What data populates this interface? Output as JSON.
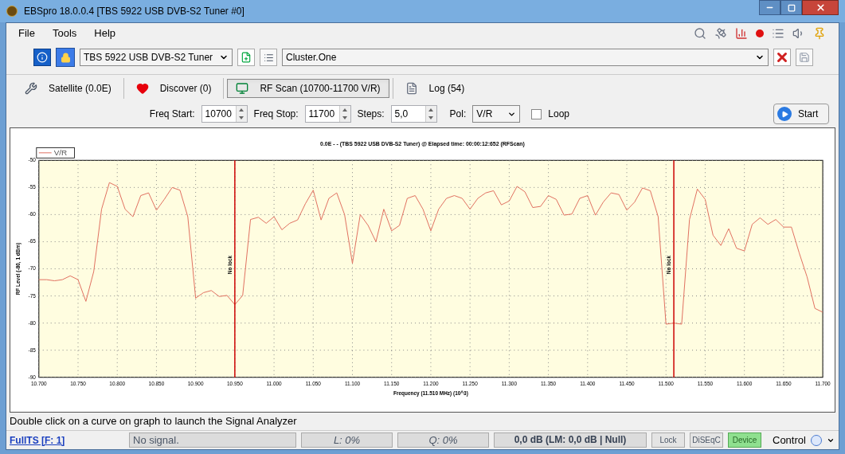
{
  "window": {
    "title": "EBSpro 18.0.0.4 [TBS 5922 USB DVB-S2 Tuner #0]"
  },
  "menu": [
    "File",
    "Tools",
    "Help"
  ],
  "toolbar": {
    "tuner": "TBS 5922 USB DVB-S2 Tuner",
    "cluster": "Cluster.One"
  },
  "tabs": [
    {
      "label": "Satellite (0.0E)",
      "selected": false,
      "kind": "satellite"
    },
    {
      "label": "Discover (0)",
      "selected": false,
      "kind": "discover"
    },
    {
      "label": "RF Scan (10700-11700 V/R)",
      "selected": true,
      "kind": "scan"
    },
    {
      "label": "Log (54)",
      "selected": false,
      "kind": "log"
    }
  ],
  "scan_settings": {
    "freq_start_label": "Freq Start:",
    "freq_start": "10700",
    "freq_stop_label": "Freq Stop:",
    "freq_stop": "11700",
    "steps_label": "Steps:",
    "steps": "5,0",
    "pol_label": "Pol:",
    "pol": "V/R",
    "loop_label": "Loop",
    "loop_checked": false,
    "start_button": "Start"
  },
  "chart_data": {
    "type": "line",
    "title": "0.0E - - (TBS 5922 USB DVB-S2 Tuner) @ Elapsed time: 00:00:12:652 (RFScan)",
    "xlabel": "Frequency (11.510 MHz) (10^3)",
    "ylabel": "RF Level (-80, 1 dBm)",
    "xlim": [
      10.7,
      11.7
    ],
    "ylim": [
      -90,
      -50
    ],
    "xticks": [
      {
        "value": 10.7,
        "label": "10.700"
      },
      {
        "value": 10.75,
        "label": "10.750"
      },
      {
        "value": 10.8,
        "label": "10.800"
      },
      {
        "value": 10.85,
        "label": "10.850"
      },
      {
        "value": 10.9,
        "label": "10.900"
      },
      {
        "value": 10.95,
        "label": "10.950"
      },
      {
        "value": 11.0,
        "label": "11.000"
      },
      {
        "value": 11.05,
        "label": "11.050"
      },
      {
        "value": 11.1,
        "label": "11.100"
      },
      {
        "value": 11.15,
        "label": "11.150"
      },
      {
        "value": 11.2,
        "label": "11.200"
      },
      {
        "value": 11.25,
        "label": "11.250"
      },
      {
        "value": 11.3,
        "label": "11.300"
      },
      {
        "value": 11.35,
        "label": "11.350"
      },
      {
        "value": 11.4,
        "label": "11.400"
      },
      {
        "value": 11.45,
        "label": "11.450"
      },
      {
        "value": 11.5,
        "label": "11.500"
      },
      {
        "value": 11.55,
        "label": "11.550"
      },
      {
        "value": 11.6,
        "label": "11.600"
      },
      {
        "value": 11.65,
        "label": "11.650"
      },
      {
        "value": 11.7,
        "label": "11.700"
      }
    ],
    "yticks": [
      -50,
      -55,
      -60,
      -65,
      -70,
      -75,
      -80,
      -85,
      -90
    ],
    "x": [
      10.7,
      10.71,
      10.72,
      10.73,
      10.74,
      10.75,
      10.76,
      10.77,
      10.78,
      10.79,
      10.8,
      10.81,
      10.82,
      10.83,
      10.84,
      10.85,
      10.86,
      10.87,
      10.88,
      10.89,
      10.9,
      10.91,
      10.92,
      10.93,
      10.94,
      10.95,
      10.96,
      10.97,
      10.98,
      10.99,
      11.0,
      11.01,
      11.02,
      11.03,
      11.04,
      11.05,
      11.06,
      11.07,
      11.08,
      11.09,
      11.1,
      11.11,
      11.12,
      11.13,
      11.14,
      11.15,
      11.16,
      11.17,
      11.18,
      11.19,
      11.2,
      11.21,
      11.22,
      11.23,
      11.24,
      11.25,
      11.26,
      11.27,
      11.28,
      11.29,
      11.3,
      11.31,
      11.32,
      11.33,
      11.34,
      11.35,
      11.36,
      11.37,
      11.38,
      11.39,
      11.4,
      11.41,
      11.42,
      11.43,
      11.44,
      11.45,
      11.46,
      11.47,
      11.48,
      11.49,
      11.5,
      11.51,
      11.52,
      11.53,
      11.54,
      11.55,
      11.56,
      11.57,
      11.58,
      11.59,
      11.6,
      11.61,
      11.62,
      11.63,
      11.64,
      11.65,
      11.66,
      11.67,
      11.68,
      11.69,
      11.7
    ],
    "series": [
      {
        "name": "V/R",
        "color": "#e07060",
        "values": [
          -72,
          -72,
          -72.2,
          -72,
          -71.3,
          -72,
          -76,
          -70.5,
          -59,
          -54.1,
          -54.8,
          -59,
          -60.4,
          -56.5,
          -56,
          -59.2,
          -57.2,
          -55,
          -55.5,
          -60.4,
          -75.4,
          -74.4,
          -74,
          -75.1,
          -74.9,
          -76.6,
          -74.9,
          -60.9,
          -60.5,
          -61.6,
          -60.4,
          -62.8,
          -61.6,
          -61,
          -58,
          -55.5,
          -61,
          -57,
          -56,
          -60,
          -69,
          -60,
          -62,
          -65,
          -59,
          -63,
          -62,
          -57,
          -56.5,
          -59,
          -63,
          -59,
          -57,
          -56.5,
          -57,
          -59,
          -57,
          -56,
          -55.6,
          -58.2,
          -57.5,
          -54.8,
          -55.8,
          -58.7,
          -58.5,
          -56.5,
          -57.2,
          -60.1,
          -59.9,
          -57,
          -56.5,
          -60.1,
          -57.7,
          -56,
          -56.3,
          -59.2,
          -57.7,
          -55.1,
          -55.6,
          -60.4,
          -80.2,
          -80,
          -80.2,
          -60.9,
          -55.3,
          -57.2,
          -63.8,
          -65.7,
          -62.6,
          -66.2,
          -66.7,
          -61.8,
          -60.6,
          -61.8,
          -60.9,
          -62.3,
          -62.3,
          -67.1,
          -71.5,
          -77.3,
          -78
        ]
      }
    ],
    "grid": true,
    "ref_lines": [
      {
        "axis": "x",
        "value": 10.95,
        "label": "No lock",
        "color": "#cc0000"
      },
      {
        "axis": "x",
        "value": 11.51,
        "label": "No lock",
        "color": "#cc0000"
      }
    ]
  },
  "hint": "Double click on a curve on graph to launch the Signal Analyzer",
  "status_bar": {
    "link": "FullTS [F: 1]",
    "signal": "No signal.",
    "level": "L: 0%",
    "quality": "Q: 0%",
    "snr": "0,0 dB (LM: 0,0 dB | Null)",
    "indicators": [
      {
        "label": "Lock",
        "on": false
      },
      {
        "label": "DiSEqC",
        "on": false
      },
      {
        "label": "Device",
        "on": true
      }
    ],
    "control": "Control"
  }
}
